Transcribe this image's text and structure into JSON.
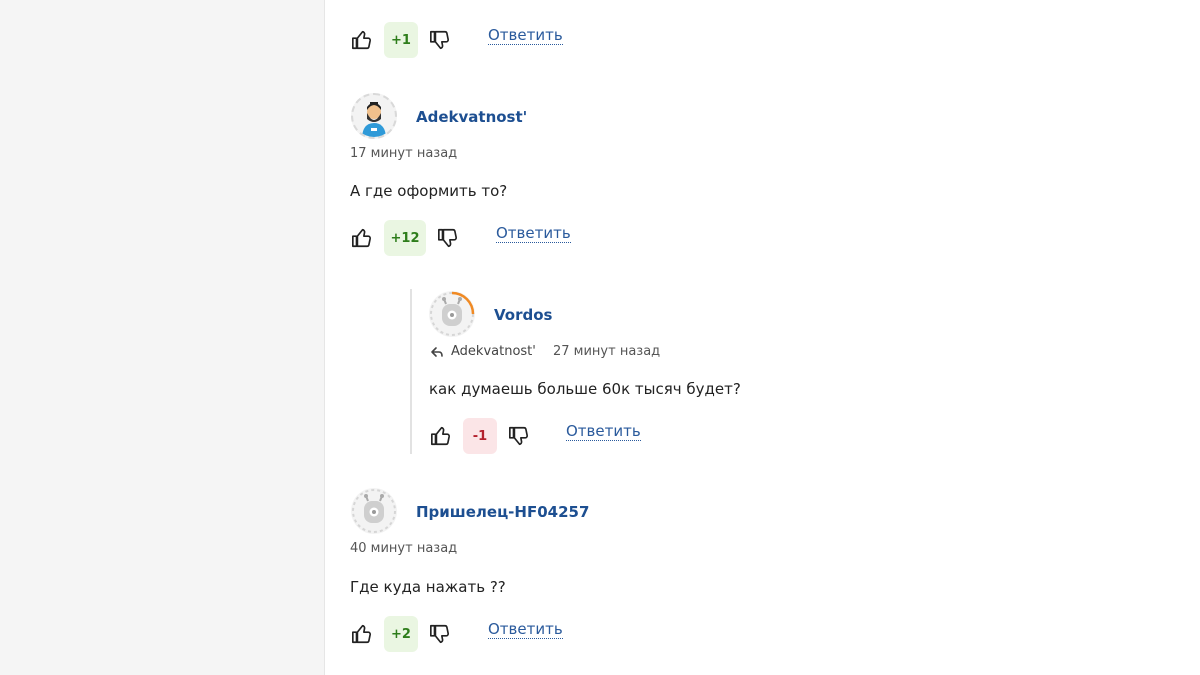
{
  "colors": {
    "username": "#1d4f91",
    "reply_link": "#2a5a9c",
    "positive_bg": "#eaf6e2",
    "positive_text": "#2e7d1b",
    "negative_bg": "#fbe5e7",
    "negative_text": "#b3202d"
  },
  "top_actions": {
    "score": "+1",
    "reply_label": "Ответить"
  },
  "comments": [
    {
      "avatar_icon": "bearded-man-avatar",
      "username": "Adekvatnost'",
      "time": "17 минут назад",
      "text": "А где оформить то?",
      "score": "+12",
      "reply_label": "Ответить"
    },
    {
      "avatar_icon": "alien-robot-avatar",
      "username": "Vordos",
      "reply_icon": "reply-arrow-icon",
      "reply_to": "Adekvatnost'",
      "time": "27 минут назад",
      "text": "как думаешь больше 60к тысяч будет?",
      "score": "-1",
      "reply_label": "Ответить"
    },
    {
      "avatar_icon": "alien-robot-avatar",
      "username": "Пришелец-HF04257",
      "time": "40 минут назад",
      "text": "Где куда нажать ??",
      "score": "+2",
      "reply_label": "Ответить"
    }
  ]
}
